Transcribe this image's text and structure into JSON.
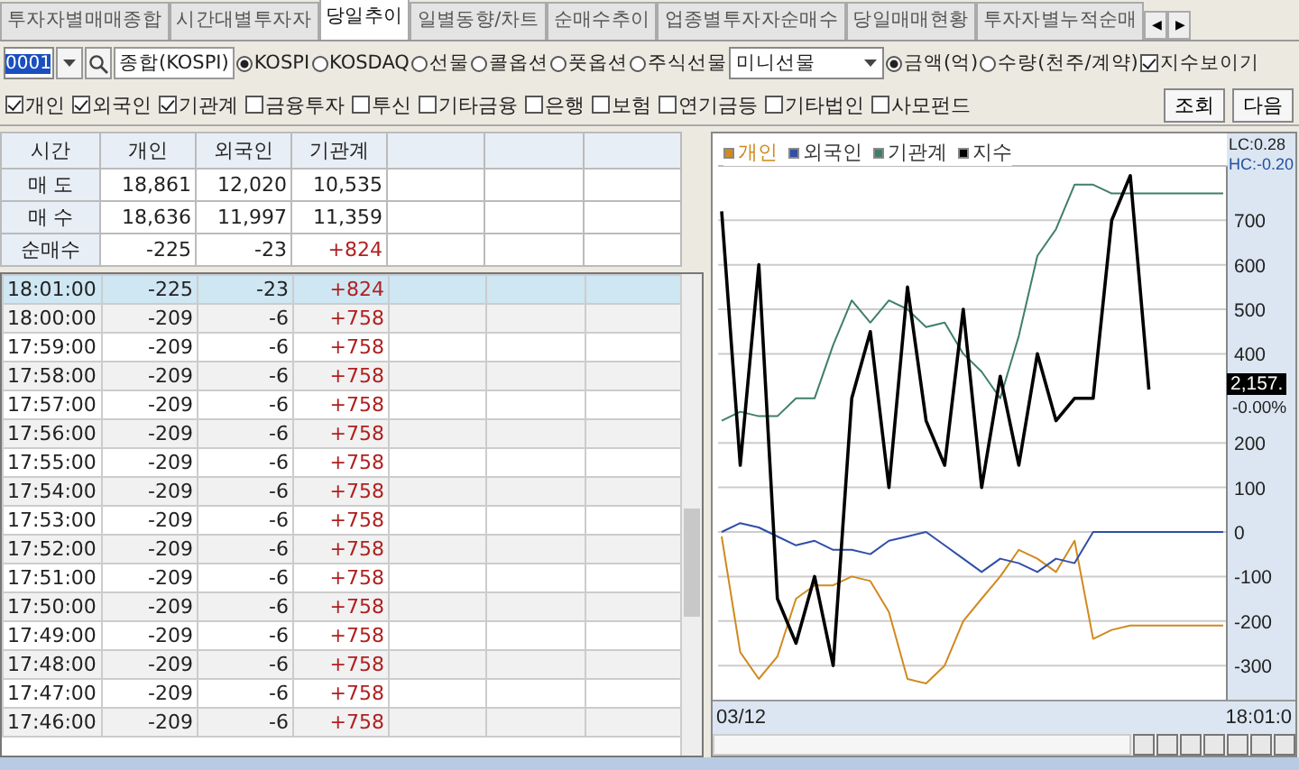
{
  "tabs": [
    {
      "label": "투자자별매매종합",
      "selected": false
    },
    {
      "label": "시간대별투자자",
      "selected": false
    },
    {
      "label": "당일추이",
      "selected": true
    },
    {
      "label": "일별동향/차트",
      "selected": false
    },
    {
      "label": "순매수추이",
      "selected": false
    },
    {
      "label": "업종별투자자순매수",
      "selected": false
    },
    {
      "label": "당일매매현황",
      "selected": false
    },
    {
      "label": "투자자별누적순매",
      "selected": false
    }
  ],
  "tab_scroll": [
    "◀",
    "▶"
  ],
  "toolbar": {
    "code": "0001",
    "market_name": "종합(KOSPI)",
    "markets": [
      {
        "label": "KOSPI",
        "selected": true
      },
      {
        "label": "KOSDAQ",
        "selected": false
      },
      {
        "label": "선물",
        "selected": false
      },
      {
        "label": "콜옵션",
        "selected": false
      },
      {
        "label": "풋옵션",
        "selected": false
      },
      {
        "label": "주식선물",
        "selected": false
      }
    ],
    "futures_select": "미니선물",
    "units": [
      {
        "label": "금액(억)",
        "selected": true
      },
      {
        "label": "수량(천주/계약)",
        "selected": false
      }
    ],
    "show_index": {
      "label": "지수보이기",
      "checked": true
    }
  },
  "investors": [
    {
      "label": "개인",
      "checked": true
    },
    {
      "label": "외국인",
      "checked": true
    },
    {
      "label": "기관계",
      "checked": true
    },
    {
      "label": "금융투자",
      "checked": false
    },
    {
      "label": "투신",
      "checked": false
    },
    {
      "label": "기타금융",
      "checked": false
    },
    {
      "label": "은행",
      "checked": false
    },
    {
      "label": "보험",
      "checked": false
    },
    {
      "label": "연기금등",
      "checked": false
    },
    {
      "label": "기타법인",
      "checked": false
    },
    {
      "label": "사모펀드",
      "checked": false
    }
  ],
  "buttons": [
    "조회",
    "다음"
  ],
  "summary": {
    "columns": [
      "시간",
      "개인",
      "외국인",
      "기관계"
    ],
    "rows": [
      {
        "kind": "trade",
        "cells": [
          "매 도",
          "18,861",
          "12,020",
          "10,535"
        ]
      },
      {
        "kind": "trade",
        "cells": [
          "매 수",
          "18,636",
          "11,997",
          "11,359"
        ]
      },
      {
        "kind": "net",
        "cells": [
          "순매수",
          "-225",
          "-23",
          "+824"
        ]
      }
    ]
  },
  "table": {
    "rows": [
      {
        "selected": true,
        "cells": [
          "18:01:00",
          "-225",
          "-23",
          "+824"
        ]
      },
      {
        "selected": false,
        "cells": [
          "18:00:00",
          "-209",
          "-6",
          "+758"
        ]
      },
      {
        "selected": false,
        "cells": [
          "17:59:00",
          "-209",
          "-6",
          "+758"
        ]
      },
      {
        "selected": false,
        "cells": [
          "17:58:00",
          "-209",
          "-6",
          "+758"
        ]
      },
      {
        "selected": false,
        "cells": [
          "17:57:00",
          "-209",
          "-6",
          "+758"
        ]
      },
      {
        "selected": false,
        "cells": [
          "17:56:00",
          "-209",
          "-6",
          "+758"
        ]
      },
      {
        "selected": false,
        "cells": [
          "17:55:00",
          "-209",
          "-6",
          "+758"
        ]
      },
      {
        "selected": false,
        "cells": [
          "17:54:00",
          "-209",
          "-6",
          "+758"
        ]
      },
      {
        "selected": false,
        "cells": [
          "17:53:00",
          "-209",
          "-6",
          "+758"
        ]
      },
      {
        "selected": false,
        "cells": [
          "17:52:00",
          "-209",
          "-6",
          "+758"
        ]
      },
      {
        "selected": false,
        "cells": [
          "17:51:00",
          "-209",
          "-6",
          "+758"
        ]
      },
      {
        "selected": false,
        "cells": [
          "17:50:00",
          "-209",
          "-6",
          "+758"
        ]
      },
      {
        "selected": false,
        "cells": [
          "17:49:00",
          "-209",
          "-6",
          "+758"
        ]
      },
      {
        "selected": false,
        "cells": [
          "17:48:00",
          "-209",
          "-6",
          "+758"
        ]
      },
      {
        "selected": false,
        "cells": [
          "17:47:00",
          "-209",
          "-6",
          "+758"
        ]
      },
      {
        "selected": false,
        "cells": [
          "17:46:00",
          "-209",
          "-6",
          "+758"
        ]
      }
    ]
  },
  "chart": {
    "chart_data": {
      "type": "line",
      "grid": true,
      "ylim": [
        -409,
        822
      ],
      "yticks": [
        700,
        600,
        500,
        400,
        200,
        100,
        0,
        -100,
        -200,
        -300
      ],
      "series": [
        {
          "name": "개인",
          "color": "#d08a1e",
          "values": [
            -10,
            -270,
            -330,
            -280,
            -150,
            -120,
            -120,
            -100,
            -110,
            -180,
            -330,
            -340,
            -300,
            -200,
            -150,
            -100,
            -40,
            -60,
            -90,
            -20,
            -240,
            -220,
            -210,
            -210,
            -210,
            -210,
            -210,
            -210
          ]
        },
        {
          "name": "외국인",
          "color": "#2f4fa8",
          "values": [
            0,
            20,
            10,
            -10,
            -30,
            -20,
            -40,
            -40,
            -50,
            -20,
            -10,
            0,
            -30,
            -60,
            -90,
            -60,
            -70,
            -90,
            -60,
            -70,
            0,
            0,
            0,
            0,
            0,
            0,
            0,
            0
          ]
        },
        {
          "name": "기관계",
          "color": "#3f7f6a",
          "values": [
            250,
            270,
            260,
            260,
            300,
            300,
            420,
            520,
            470,
            520,
            500,
            460,
            470,
            400,
            360,
            300,
            440,
            620,
            680,
            780,
            780,
            760,
            760,
            760,
            760,
            760,
            760,
            760
          ]
        },
        {
          "name": "지수",
          "color": "#000000",
          "values": [
            720,
            150,
            600,
            -150,
            -250,
            -100,
            -300,
            300,
            450,
            100,
            550,
            250,
            150,
            500,
            100,
            350,
            150,
            400,
            250,
            300,
            300,
            700,
            800,
            320,
            null,
            null,
            null,
            null
          ]
        }
      ]
    },
    "lc": "LC:0.28",
    "hc": "HC:-0.20",
    "index_value": "2,157.",
    "index_change": "-0.00%",
    "date": "03/12",
    "time": "18:01:0"
  }
}
